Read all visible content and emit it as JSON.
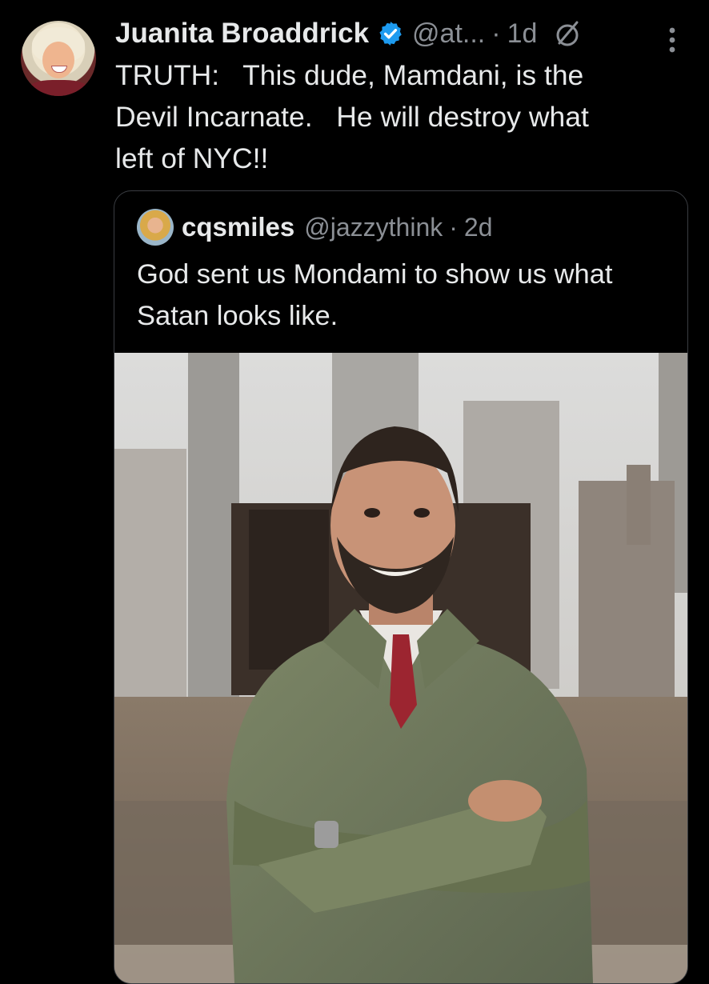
{
  "post": {
    "author": {
      "display_name": "Juanita Broaddrick",
      "handle": "@at...",
      "verified": true,
      "avatar_icon": "profile-photo"
    },
    "separator": "·",
    "timestamp": "1d",
    "grok_icon": "grok-icon",
    "more_icon": "more-vertical-icon",
    "text": "TRUTH:   This dude, Mamdani, is the\nDevil Incarnate.   He will destroy what\nleft of NYC!!"
  },
  "quoted_post": {
    "author": {
      "display_name": "cqsmiles",
      "handle": "@jazzythink",
      "avatar_icon": "profile-photo"
    },
    "separator": "·",
    "timestamp": "2d",
    "text": "God sent us Mondami to show us\nwhat Satan looks like.",
    "media": {
      "type": "photo",
      "subject": "man in olive jacket, arms crossed, city skyline behind"
    }
  },
  "colors": {
    "background": "#000000",
    "primary_text": "#e7e9ea",
    "secondary_text": "#8b8f95",
    "verified_badge": "#1d9bf0",
    "card_border": "#3a3d42"
  }
}
